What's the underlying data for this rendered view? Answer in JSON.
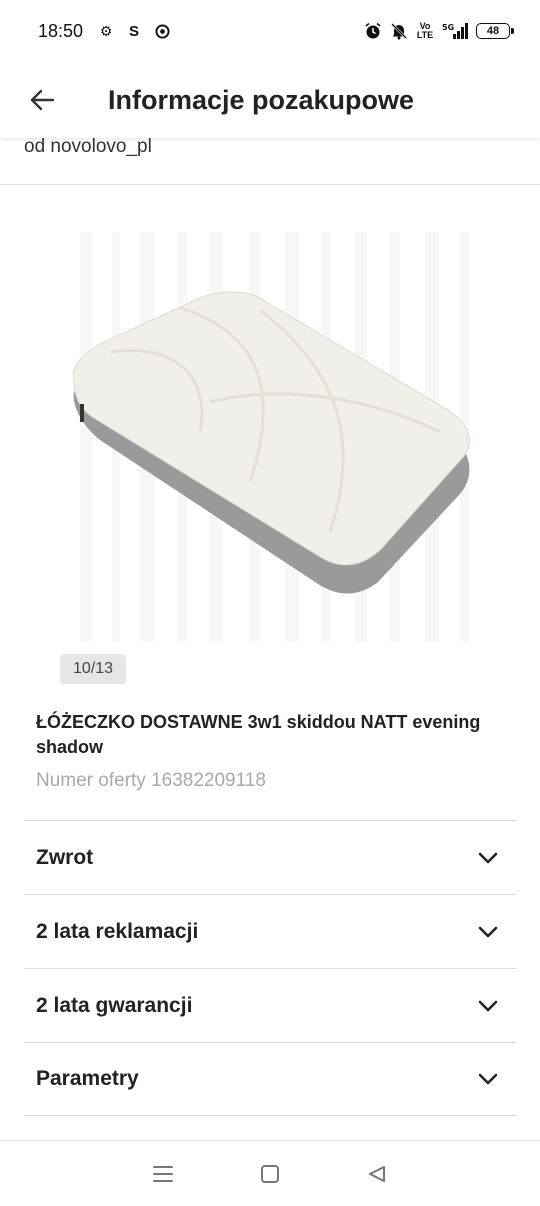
{
  "status_bar": {
    "time": "18:50",
    "left_icons": [
      "gear-icon",
      "s-app-icon",
      "chrome-icon"
    ],
    "right_icons": [
      "alarm-icon",
      "mute-icon",
      "volte-icon",
      "5g-signal-icon"
    ],
    "volte_label": "Vo\nLTE",
    "network_label": "5G",
    "battery": "48"
  },
  "app_bar": {
    "title": "Informacje pozakupowe",
    "back_icon": "arrow-left-icon"
  },
  "seller": "od novolovo_pl",
  "product": {
    "image_counter": "10/13",
    "title": "ŁÓŻECZKO DOSTAWNE 3w1 skiddou NATT evening shadow",
    "offer_number": "Numer oferty 16382209118"
  },
  "accordion": [
    {
      "label": "Zwrot"
    },
    {
      "label": "2 lata reklamacji"
    },
    {
      "label": "2 lata gwarancji"
    },
    {
      "label": "Parametry"
    }
  ],
  "nav_bar": {
    "icons": [
      "menu-icon",
      "home-square-icon",
      "back-triangle-icon"
    ]
  }
}
